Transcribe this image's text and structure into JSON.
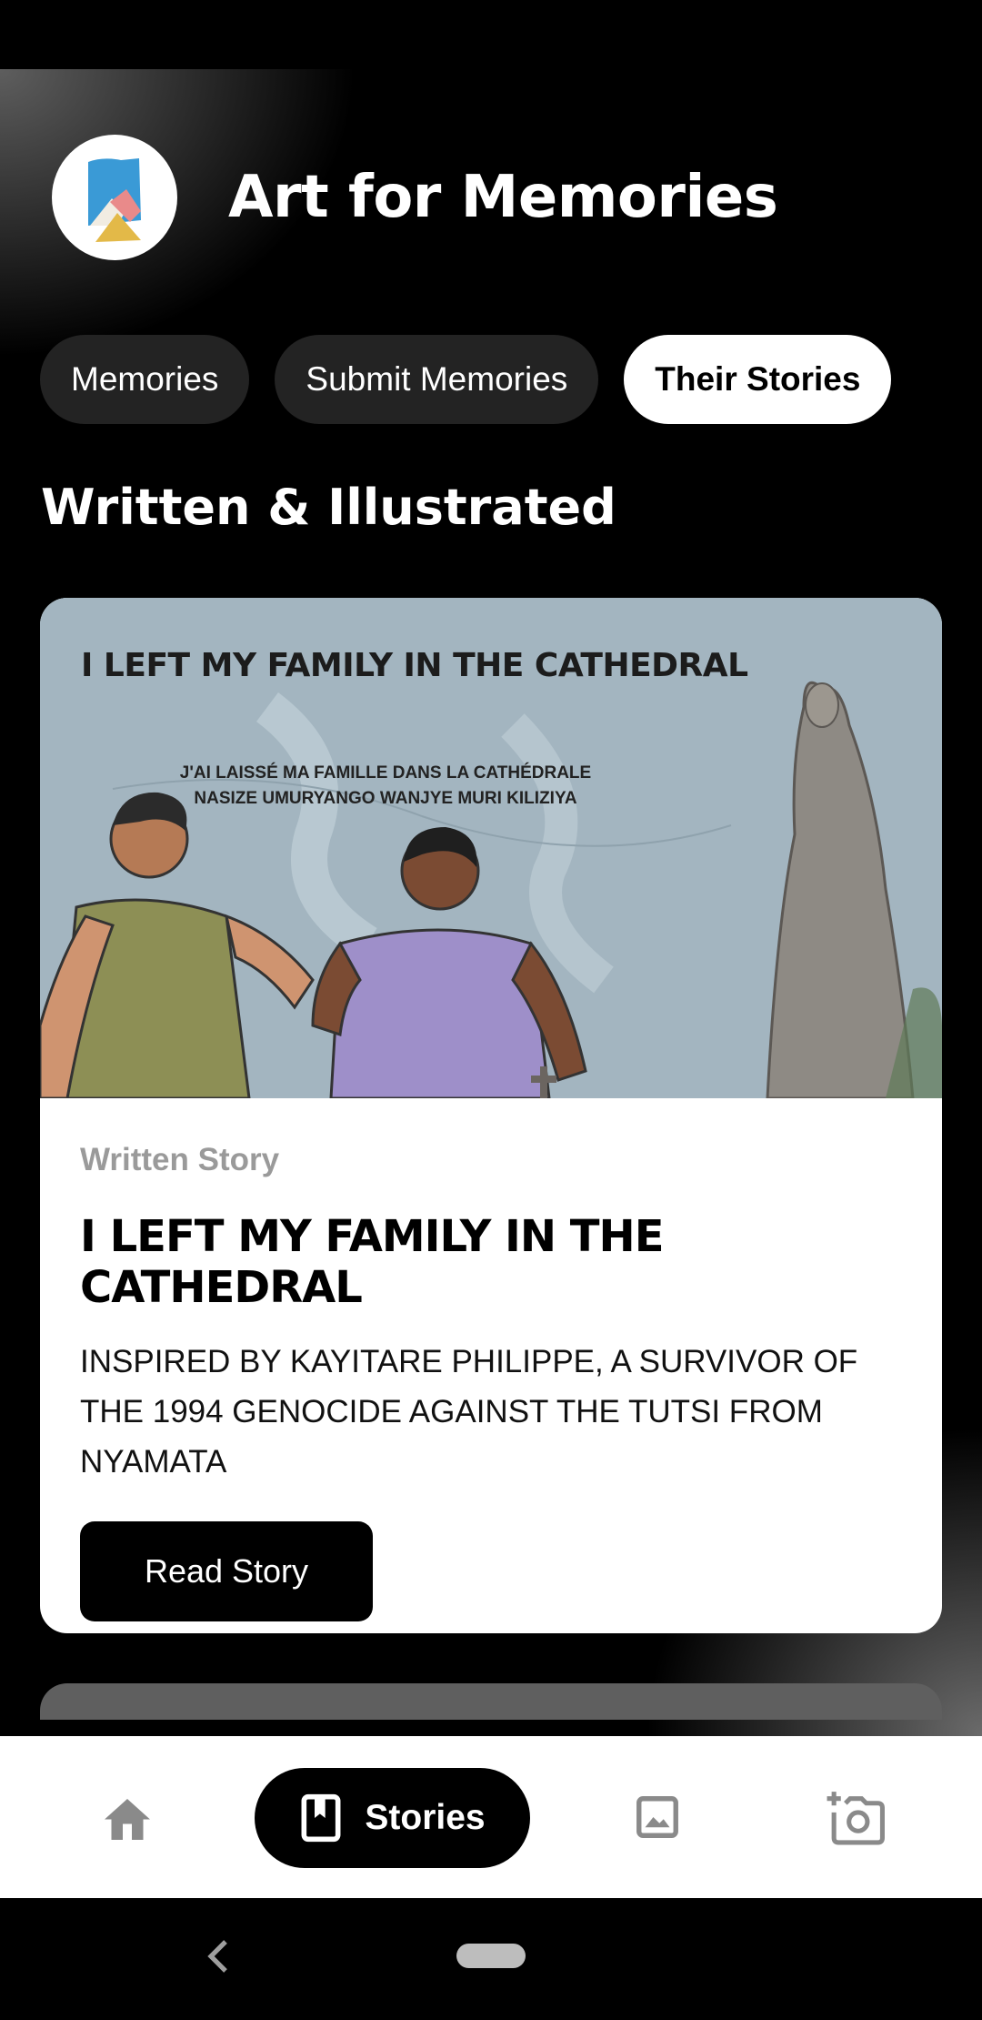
{
  "app": {
    "title": "Art for Memories",
    "logo_icon": "art-for-memories-logo"
  },
  "tabs": [
    {
      "label": "Memories",
      "active": false
    },
    {
      "label": "Submit Memories",
      "active": false
    },
    {
      "label": "Their Stories",
      "active": true
    }
  ],
  "section": {
    "title": "Written & Illustrated"
  },
  "story_card": {
    "image": {
      "title": "I LEFT MY FAMILY IN THE CATHEDRAL",
      "subtitle_fr": "J'AI LAISSÉ MA FAMILLE DANS LA CATHÉDRALE",
      "subtitle_rw": "NASIZE UMURYANGO WANJYE MURI KILIZIYA"
    },
    "kicker": "Written Story",
    "title": "I LEFT MY FAMILY IN THE CATHEDRAL",
    "description": "INSPIRED BY KAYITARE PHILIPPE, A SURVIVOR OF THE 1994 GENOCIDE AGAINST THE TUTSI FROM NYAMATA",
    "button_label": "Read Story"
  },
  "bottom_nav": {
    "items": [
      {
        "icon": "home-icon",
        "label": ""
      },
      {
        "icon": "book-icon",
        "label": "Stories",
        "active": true
      },
      {
        "icon": "image-icon",
        "label": ""
      },
      {
        "icon": "add-photo-icon",
        "label": ""
      }
    ]
  },
  "colors": {
    "background": "#000000",
    "card": "#ffffff",
    "accent": "#000000",
    "tab_inactive": "#232323",
    "muted_text": "#9a9a9a"
  }
}
